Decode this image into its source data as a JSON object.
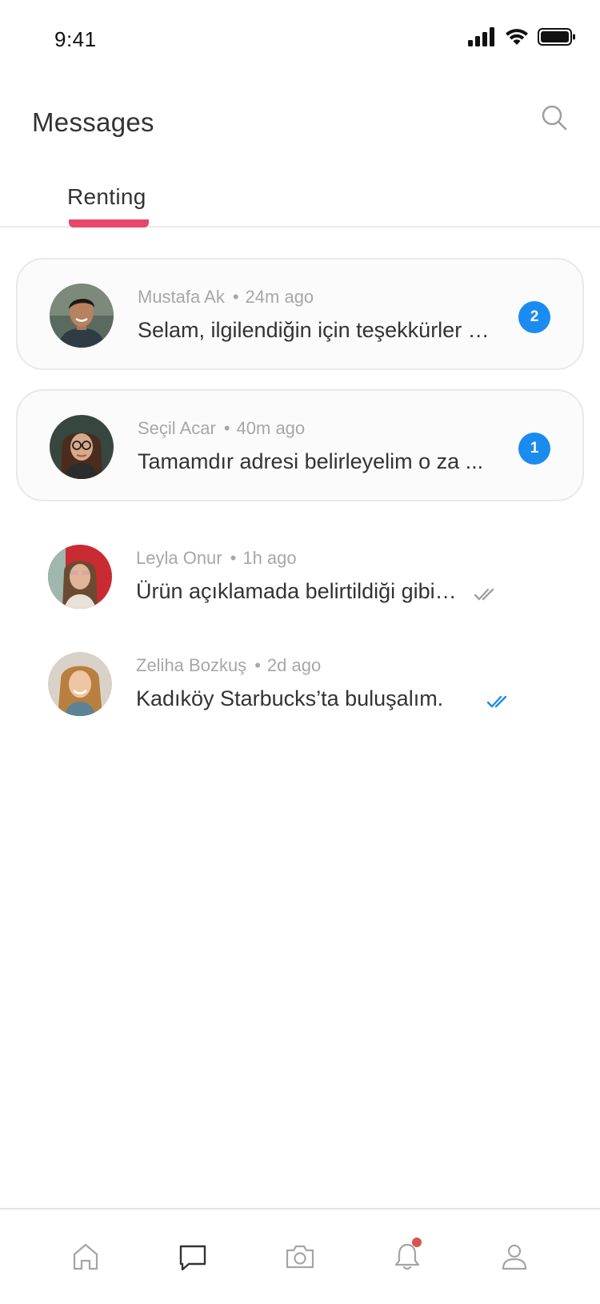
{
  "status_bar": {
    "time": "9:41"
  },
  "header": {
    "title": "Messages"
  },
  "tabs": {
    "items": [
      {
        "label": "Renting",
        "active": true
      }
    ]
  },
  "conversations": [
    {
      "name": "Mustafa Ak",
      "time": "24m ago",
      "preview": "Selam, ilgilendiğin için teşekkürler …",
      "unread_count": "2",
      "state": "unread"
    },
    {
      "name": "Seçil Acar",
      "time": "40m ago",
      "preview": "Tamamdır adresi belirleyelim o za ...",
      "unread_count": "1",
      "state": "unread"
    },
    {
      "name": "Leyla Onur",
      "time": "1h ago",
      "preview": "Ürün açıklamada belirtildiği gibi…",
      "state": "delivered"
    },
    {
      "name": "Zeliha Bozkuş",
      "time": "2d ago",
      "preview": "Kadıköy Starbucks’ta buluşalım.",
      "state": "read"
    }
  ],
  "nav": {
    "items": [
      {
        "icon": "home-icon"
      },
      {
        "icon": "chat-icon",
        "active": true
      },
      {
        "icon": "camera-icon"
      },
      {
        "icon": "bell-icon",
        "has_notification": true
      },
      {
        "icon": "profile-icon"
      }
    ]
  },
  "colors": {
    "accent": "#e8466a",
    "badge": "#1a8cf0",
    "read_check": "#1a8cf0",
    "delivered_check": "#a0a0a0",
    "notification_dot": "#d9534f"
  }
}
